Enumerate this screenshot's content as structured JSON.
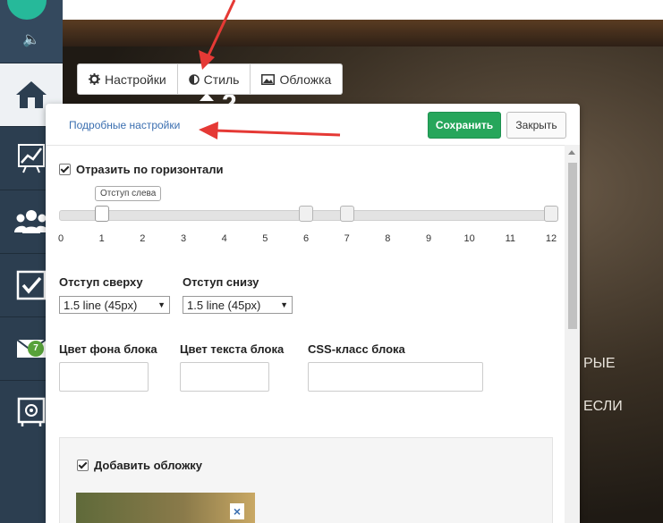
{
  "sidebar": {
    "badge": "7",
    "items": [
      {
        "icon": "home-icon"
      },
      {
        "icon": "chart-icon"
      },
      {
        "icon": "users-icon"
      },
      {
        "icon": "tasks-icon"
      },
      {
        "icon": "mail-icon"
      },
      {
        "icon": "safe-icon"
      }
    ]
  },
  "tabs": [
    {
      "label": "Настройки",
      "icon": "gear-icon"
    },
    {
      "label": "Стиль",
      "icon": "contrast-icon"
    },
    {
      "label": "Обложка",
      "icon": "image-icon"
    }
  ],
  "background": {
    "heading_fragment": "2",
    "text_line1": "РЫЕ",
    "text_line2": "ЕСЛИ"
  },
  "panel": {
    "advanced_link": "Подробные настройки",
    "save_label": "Сохранить",
    "close_label": "Закрыть",
    "flip_label": "Отразить по горизонтали",
    "slider": {
      "tooltip": "Отступ слева",
      "ticks": [
        "0",
        "1",
        "2",
        "3",
        "4",
        "5",
        "6",
        "7",
        "8",
        "9",
        "10",
        "11",
        "12"
      ],
      "left_value": 1,
      "handles": [
        1,
        6,
        7,
        12
      ]
    },
    "padding_top_label": "Отступ сверху",
    "padding_top_value": "1.5 line (45px)",
    "padding_bottom_label": "Отступ снизу",
    "padding_bottom_value": "1.5 line (45px)",
    "bg_color_label": "Цвет фона блока",
    "text_color_label": "Цвет текста блока",
    "css_class_label": "CSS-класс блока",
    "add_cover_label": "Добавить обложку",
    "remove_cover": "×"
  },
  "colors": {
    "save": "#26a65b",
    "link": "#3b6fb0",
    "sidebar": "#2c3e50",
    "arrow": "#e53935"
  }
}
